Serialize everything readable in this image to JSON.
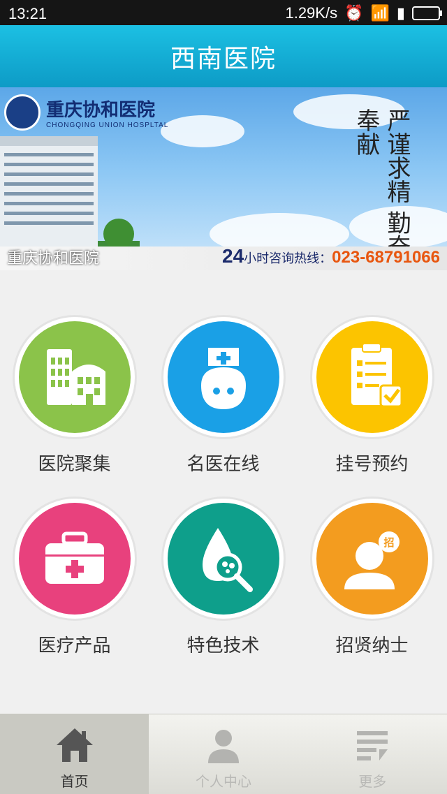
{
  "status_bar": {
    "time": "13:21",
    "speed": "1.29K/s"
  },
  "title": "西南医院",
  "banner": {
    "hospital_name_cn": "重庆协和医院",
    "hospital_name_en": "CHONGQING UNION HOSPLTAL",
    "calligraphy": "严谨求精 勤奋奉献",
    "hotline_prefix": "24",
    "hotline_label": "小时咨询热线：",
    "hotline_number": "023-68791066",
    "caption": "重庆协和医院"
  },
  "menu": [
    {
      "label": "医院聚集",
      "color": "#8bc34a",
      "icon": "hospital-building-icon"
    },
    {
      "label": "名医在线",
      "color": "#1aa0e6",
      "icon": "nurse-icon"
    },
    {
      "label": "挂号预约",
      "color": "#fcc400",
      "icon": "clipboard-check-icon"
    },
    {
      "label": "医疗产品",
      "color": "#e8417d",
      "icon": "medical-kit-icon"
    },
    {
      "label": "特色技术",
      "color": "#0e9f8b",
      "icon": "drop-magnifier-icon"
    },
    {
      "label": "招贤纳士",
      "color": "#f39c1f",
      "icon": "recruit-person-icon"
    }
  ],
  "tabs": [
    {
      "label": "首页",
      "icon": "home-icon",
      "active": true
    },
    {
      "label": "个人中心",
      "icon": "person-icon",
      "active": false
    },
    {
      "label": "更多",
      "icon": "list-icon",
      "active": false
    }
  ]
}
